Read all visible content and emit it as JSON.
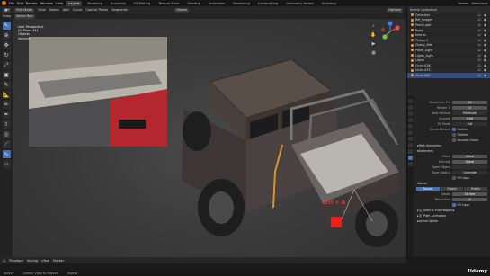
{
  "topbar": {
    "menus": [
      "File",
      "Edit",
      "Render",
      "Window",
      "Help"
    ],
    "workspaces": [
      "Layout",
      "Modeling",
      "Sculpting",
      "UV Editing",
      "Texture Paint",
      "Shading",
      "Animation",
      "Rendering",
      "Compositing",
      "Geometry Nodes",
      "Scripting"
    ],
    "scene": "Scene",
    "view_layer": "ViewLayer"
  },
  "header": {
    "object_mode": "Edit Mode",
    "menus": [
      "View",
      "Select",
      "Add",
      "Curve",
      "Control Points",
      "Segments"
    ],
    "transform": "Global",
    "options": "Options"
  },
  "header3": {
    "drag": "Drag",
    "select_box": "Select Box"
  },
  "viewport": {
    "info": [
      "User Perspective",
      "(0) Plane.141",
      "Objects",
      "Vertices"
    ],
    "hint": "Ctrl + A"
  },
  "outliner": {
    "title": "Scene Collection",
    "items": [
      "Collection",
      "Ref_Images",
      "Point Light",
      "Body",
      "Interior",
      "Things 2",
      "Glossy_Bits",
      "Plane_Light",
      "Lights_Light",
      "Lights",
      "Circle.036",
      "Circle.033",
      "Circle.082"
    ]
  },
  "properties": {
    "rows": [
      {
        "k": "Resolution Pre",
        "v": "12"
      },
      {
        "k": "Render U",
        "v": "0"
      },
      {
        "k": "Twist Method",
        "v": "Minimum"
      },
      {
        "k": "Smooth",
        "v": "0.00"
      },
      {
        "k": "Fill Mode",
        "v": "Full"
      }
    ],
    "curve_deform": "Curve Deform",
    "radius": "Radius",
    "stretch": "Stretch",
    "bounds_clamp": "Bounds Clamp",
    "path_animation": "Path Animation",
    "section_geometry": "Geometry",
    "geometry_rows": [
      {
        "k": "Offset",
        "v": "0 mm"
      },
      {
        "k": "Extrude",
        "v": "0 mm"
      },
      {
        "k": "Taper Object",
        "v": ""
      },
      {
        "k": "Taper Radius",
        "v": "Override"
      }
    ],
    "fill_caps": "Fill Caps",
    "bevel": "Bevel",
    "bevel_modes": [
      "Round",
      "Object",
      "Profile"
    ],
    "bevel_rows": [
      {
        "k": "Depth",
        "v": "18 mm"
      },
      {
        "k": "Resolution",
        "v": "4"
      }
    ],
    "fill_caps2": "Fill Caps",
    "start_end": "Start & End Mapping",
    "path_animation2": "Path Animation",
    "active_spline": "Active Spline"
  },
  "timeline": {
    "playback": "Playback",
    "keying": "Keying",
    "view": "View",
    "marker": "Marker"
  },
  "status": {
    "left": "Select",
    "mid": "Center View to Mouse",
    "right": "Object"
  },
  "watermark": "Udemy"
}
